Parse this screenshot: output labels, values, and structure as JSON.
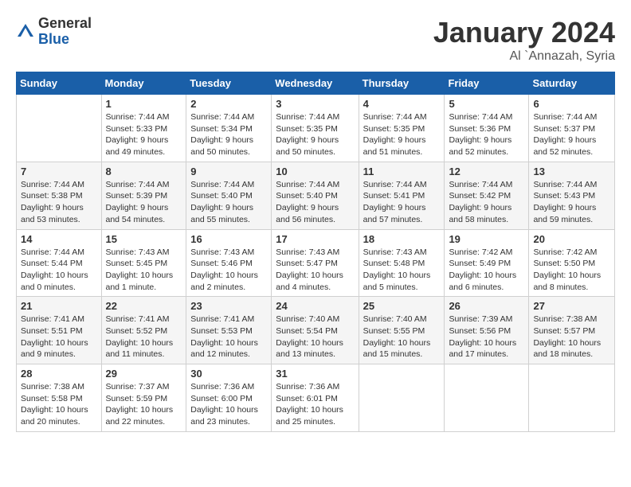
{
  "header": {
    "logo_general": "General",
    "logo_blue": "Blue",
    "month_title": "January 2024",
    "location": "Al `Annazah, Syria"
  },
  "weekdays": [
    "Sunday",
    "Monday",
    "Tuesday",
    "Wednesday",
    "Thursday",
    "Friday",
    "Saturday"
  ],
  "weeks": [
    [
      {
        "day": "",
        "sunrise": "",
        "sunset": "",
        "daylight": ""
      },
      {
        "day": "1",
        "sunrise": "Sunrise: 7:44 AM",
        "sunset": "Sunset: 5:33 PM",
        "daylight": "Daylight: 9 hours and 49 minutes."
      },
      {
        "day": "2",
        "sunrise": "Sunrise: 7:44 AM",
        "sunset": "Sunset: 5:34 PM",
        "daylight": "Daylight: 9 hours and 50 minutes."
      },
      {
        "day": "3",
        "sunrise": "Sunrise: 7:44 AM",
        "sunset": "Sunset: 5:35 PM",
        "daylight": "Daylight: 9 hours and 50 minutes."
      },
      {
        "day": "4",
        "sunrise": "Sunrise: 7:44 AM",
        "sunset": "Sunset: 5:35 PM",
        "daylight": "Daylight: 9 hours and 51 minutes."
      },
      {
        "day": "5",
        "sunrise": "Sunrise: 7:44 AM",
        "sunset": "Sunset: 5:36 PM",
        "daylight": "Daylight: 9 hours and 52 minutes."
      },
      {
        "day": "6",
        "sunrise": "Sunrise: 7:44 AM",
        "sunset": "Sunset: 5:37 PM",
        "daylight": "Daylight: 9 hours and 52 minutes."
      }
    ],
    [
      {
        "day": "7",
        "sunrise": "Sunrise: 7:44 AM",
        "sunset": "Sunset: 5:38 PM",
        "daylight": "Daylight: 9 hours and 53 minutes."
      },
      {
        "day": "8",
        "sunrise": "Sunrise: 7:44 AM",
        "sunset": "Sunset: 5:39 PM",
        "daylight": "Daylight: 9 hours and 54 minutes."
      },
      {
        "day": "9",
        "sunrise": "Sunrise: 7:44 AM",
        "sunset": "Sunset: 5:40 PM",
        "daylight": "Daylight: 9 hours and 55 minutes."
      },
      {
        "day": "10",
        "sunrise": "Sunrise: 7:44 AM",
        "sunset": "Sunset: 5:40 PM",
        "daylight": "Daylight: 9 hours and 56 minutes."
      },
      {
        "day": "11",
        "sunrise": "Sunrise: 7:44 AM",
        "sunset": "Sunset: 5:41 PM",
        "daylight": "Daylight: 9 hours and 57 minutes."
      },
      {
        "day": "12",
        "sunrise": "Sunrise: 7:44 AM",
        "sunset": "Sunset: 5:42 PM",
        "daylight": "Daylight: 9 hours and 58 minutes."
      },
      {
        "day": "13",
        "sunrise": "Sunrise: 7:44 AM",
        "sunset": "Sunset: 5:43 PM",
        "daylight": "Daylight: 9 hours and 59 minutes."
      }
    ],
    [
      {
        "day": "14",
        "sunrise": "Sunrise: 7:44 AM",
        "sunset": "Sunset: 5:44 PM",
        "daylight": "Daylight: 10 hours and 0 minutes."
      },
      {
        "day": "15",
        "sunrise": "Sunrise: 7:43 AM",
        "sunset": "Sunset: 5:45 PM",
        "daylight": "Daylight: 10 hours and 1 minute."
      },
      {
        "day": "16",
        "sunrise": "Sunrise: 7:43 AM",
        "sunset": "Sunset: 5:46 PM",
        "daylight": "Daylight: 10 hours and 2 minutes."
      },
      {
        "day": "17",
        "sunrise": "Sunrise: 7:43 AM",
        "sunset": "Sunset: 5:47 PM",
        "daylight": "Daylight: 10 hours and 4 minutes."
      },
      {
        "day": "18",
        "sunrise": "Sunrise: 7:43 AM",
        "sunset": "Sunset: 5:48 PM",
        "daylight": "Daylight: 10 hours and 5 minutes."
      },
      {
        "day": "19",
        "sunrise": "Sunrise: 7:42 AM",
        "sunset": "Sunset: 5:49 PM",
        "daylight": "Daylight: 10 hours and 6 minutes."
      },
      {
        "day": "20",
        "sunrise": "Sunrise: 7:42 AM",
        "sunset": "Sunset: 5:50 PM",
        "daylight": "Daylight: 10 hours and 8 minutes."
      }
    ],
    [
      {
        "day": "21",
        "sunrise": "Sunrise: 7:41 AM",
        "sunset": "Sunset: 5:51 PM",
        "daylight": "Daylight: 10 hours and 9 minutes."
      },
      {
        "day": "22",
        "sunrise": "Sunrise: 7:41 AM",
        "sunset": "Sunset: 5:52 PM",
        "daylight": "Daylight: 10 hours and 11 minutes."
      },
      {
        "day": "23",
        "sunrise": "Sunrise: 7:41 AM",
        "sunset": "Sunset: 5:53 PM",
        "daylight": "Daylight: 10 hours and 12 minutes."
      },
      {
        "day": "24",
        "sunrise": "Sunrise: 7:40 AM",
        "sunset": "Sunset: 5:54 PM",
        "daylight": "Daylight: 10 hours and 13 minutes."
      },
      {
        "day": "25",
        "sunrise": "Sunrise: 7:40 AM",
        "sunset": "Sunset: 5:55 PM",
        "daylight": "Daylight: 10 hours and 15 minutes."
      },
      {
        "day": "26",
        "sunrise": "Sunrise: 7:39 AM",
        "sunset": "Sunset: 5:56 PM",
        "daylight": "Daylight: 10 hours and 17 minutes."
      },
      {
        "day": "27",
        "sunrise": "Sunrise: 7:38 AM",
        "sunset": "Sunset: 5:57 PM",
        "daylight": "Daylight: 10 hours and 18 minutes."
      }
    ],
    [
      {
        "day": "28",
        "sunrise": "Sunrise: 7:38 AM",
        "sunset": "Sunset: 5:58 PM",
        "daylight": "Daylight: 10 hours and 20 minutes."
      },
      {
        "day": "29",
        "sunrise": "Sunrise: 7:37 AM",
        "sunset": "Sunset: 5:59 PM",
        "daylight": "Daylight: 10 hours and 22 minutes."
      },
      {
        "day": "30",
        "sunrise": "Sunrise: 7:36 AM",
        "sunset": "Sunset: 6:00 PM",
        "daylight": "Daylight: 10 hours and 23 minutes."
      },
      {
        "day": "31",
        "sunrise": "Sunrise: 7:36 AM",
        "sunset": "Sunset: 6:01 PM",
        "daylight": "Daylight: 10 hours and 25 minutes."
      },
      {
        "day": "",
        "sunrise": "",
        "sunset": "",
        "daylight": ""
      },
      {
        "day": "",
        "sunrise": "",
        "sunset": "",
        "daylight": ""
      },
      {
        "day": "",
        "sunrise": "",
        "sunset": "",
        "daylight": ""
      }
    ]
  ]
}
